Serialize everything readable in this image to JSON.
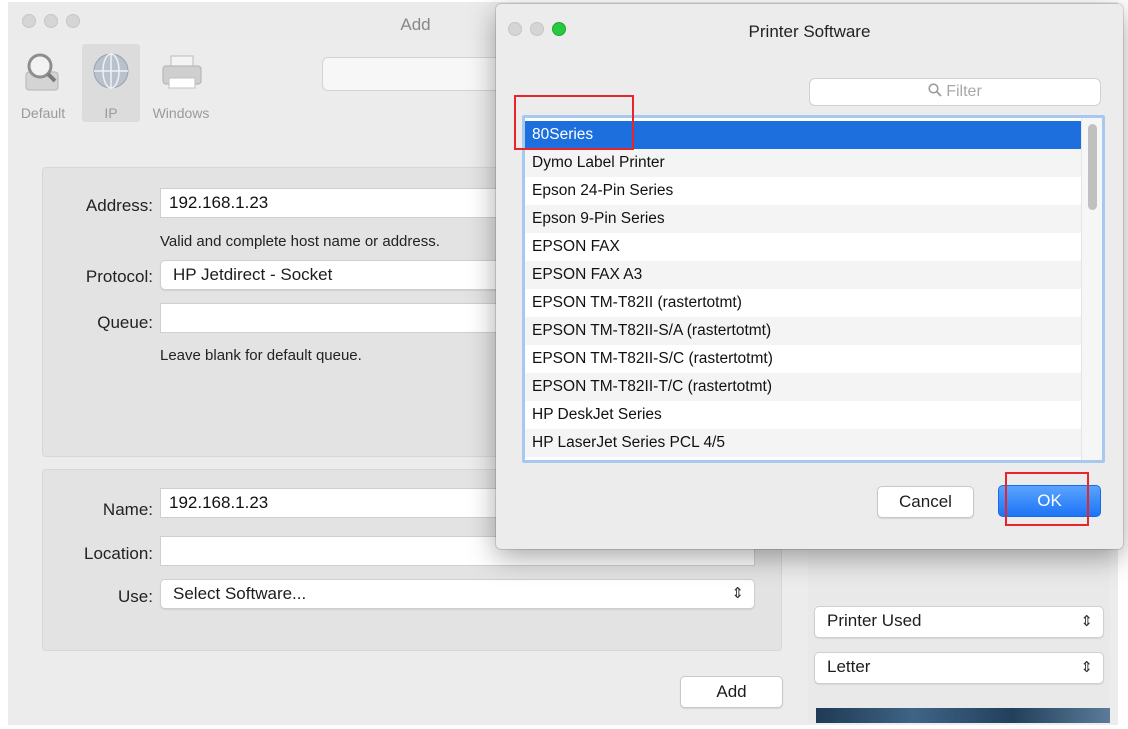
{
  "add_window": {
    "title": "Add",
    "toolbar": [
      {
        "label": "Default",
        "icon": "magnifier-icon"
      },
      {
        "label": "IP",
        "icon": "globe-icon"
      },
      {
        "label": "Windows",
        "icon": "printer-icon"
      }
    ],
    "address": {
      "label": "Address:",
      "value": "192.168.1.23",
      "hint": "Valid and complete host name or address."
    },
    "protocol": {
      "label": "Protocol:",
      "value": "HP Jetdirect - Socket"
    },
    "queue": {
      "label": "Queue:",
      "value": "",
      "hint": "Leave blank for default queue."
    },
    "name": {
      "label": "Name:",
      "value": "192.168.1.23"
    },
    "location": {
      "label": "Location:",
      "value": ""
    },
    "use": {
      "label": "Use:",
      "value": "Select Software..."
    },
    "add_button": "Add"
  },
  "background_window": {
    "printer_used": "Printer Used",
    "paper": "Letter"
  },
  "printer_software_dialog": {
    "title": "Printer Software",
    "filter_placeholder": "Filter",
    "items": [
      "80Series",
      "Dymo Label Printer",
      "Epson 24-Pin Series",
      "Epson 9-Pin Series",
      "EPSON FAX",
      "EPSON FAX A3",
      "EPSON TM-T82II (rastertotmt)",
      "EPSON TM-T82II-S/A (rastertotmt)",
      "EPSON TM-T82II-S/C (rastertotmt)",
      "EPSON TM-T82II-T/C (rastertotmt)",
      "HP DeskJet Series",
      "HP LaserJet Series PCL 4/5"
    ],
    "selected_index": 0,
    "cancel_button": "Cancel",
    "ok_button": "OK"
  },
  "colors": {
    "selection": "#1c6fdc",
    "annotation": "#e8252b",
    "primary_button": "#1d74f5"
  }
}
